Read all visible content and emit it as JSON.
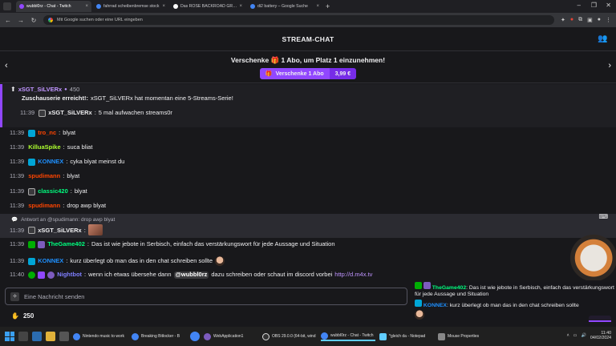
{
  "browser": {
    "tabs": [
      {
        "title": "wubbl0rz - Chat - Twitch",
        "active": true,
        "icon": "twitch-icon"
      },
      {
        "title": "fahrrad scheibenbremse stock",
        "active": false,
        "icon": "google-icon"
      },
      {
        "title": "Das ROSE BACKROAD GRX RX6",
        "active": false,
        "icon": "page-icon"
      },
      {
        "title": "di2 battery – Google Suche",
        "active": false,
        "icon": "google-icon"
      }
    ],
    "url_placeholder": "Mit Google suchen oder eine URL eingeben"
  },
  "chat": {
    "header_title": "STREAM-CHAT",
    "promo_text": "Verschenke 🎁 1 Abo, um Platz 1 einzunehmen!",
    "promo_button_label": "Verschenke 1 Abo",
    "promo_button_price": "3,99 €",
    "streak": {
      "user": "xSGT_SiLVERx",
      "points": "450",
      "headline": "Zuschauserie erreicht!:",
      "text": "xSGT_SiLVERx hat momentan eine 5-Streams-Serie!",
      "msg_time": "11:39",
      "msg_user": "xSGT_SiLVERx",
      "msg_text": "5 mal aufwachen streams0r"
    },
    "messages": [
      {
        "time": "11:39",
        "user": "tro_nc",
        "text": "blyat",
        "color": "#ff4500"
      },
      {
        "time": "11:39",
        "user": "KilluaSpike",
        "text": "suca bliat",
        "color": "#adff2f"
      },
      {
        "time": "11:39",
        "user": "KONNEX",
        "text": "cyka blyat meinst du",
        "color": "#1e90ff"
      },
      {
        "time": "11:39",
        "user": "spudimann",
        "text": "blyat",
        "color": "#ff4500"
      },
      {
        "time": "11:39",
        "user": "classic420",
        "text": "blyat",
        "color": "#00ff7f"
      },
      {
        "time": "11:39",
        "user": "spudimann",
        "text": "drop awp blyat",
        "color": "#ff4500"
      }
    ],
    "reply": {
      "context": "Antwort an @spudimann: drop awp blyat",
      "time": "11:39",
      "user": "xSGT_SiLVERx"
    },
    "messages2": [
      {
        "time": "11:39",
        "user": "TheGame402",
        "text": "Das ist wie jebote in Serbisch, einfach das verstärkungswort für jede Aussage und Situation",
        "color": "#00ff7f"
      },
      {
        "time": "11:39",
        "user": "KONNEX",
        "text": "kurz überlegt ob man das in den chat schreiben sollte",
        "color": "#1e90ff"
      }
    ],
    "last": {
      "time": "11:40",
      "user": "Nightbot",
      "text_before": "wenn ich etwas übersehe dann",
      "mention": "@wubbl0rz",
      "text_after": "dazu schreiben oder schaut im discord vorbei",
      "link": "http://d.m4x.tv",
      "color": "#7f7fff"
    },
    "input_placeholder": "Eine Nachricht senden",
    "channel_points": "250"
  },
  "overlay": {
    "msg1_user": "TheGame402",
    "msg1_text": "Das ist wie jebote in Serbisch, einfach das verstärkungswort für jede Aussage und Situation",
    "msg2_user": "KONNEX",
    "msg2_text": "kurz überlegt ob man das in den chat schreiben sollte"
  },
  "taskbar": {
    "tasks": [
      "Nintendo music to work",
      "Breaking Bitlocker - B",
      "WebApplication1",
      "OBS 29.0.0 (64-bit, wind",
      "wubbl0rz - Chat - Twitch",
      "*gleich da - Notepad",
      "Mouse Properties"
    ],
    "time": "11:40",
    "date": "04/02/2024"
  }
}
